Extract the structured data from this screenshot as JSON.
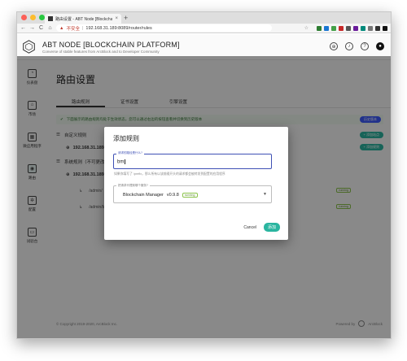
{
  "browser": {
    "tab_title": "路由设置 - ABT Node [Blockchain Pla…",
    "tab_close": "×",
    "new_tab": "+",
    "nav": {
      "back": "←",
      "forward": "→",
      "reload": "C",
      "home": "⌂"
    },
    "security_label": "不安全",
    "url": "192.168.31.189:8089/router/rules",
    "star": "☆"
  },
  "app": {
    "title": "ABT NODE [BLOCKCHAIN PLATFORM]",
    "subtitle": "Converse of stable features from ArcBlock and to Developer Community",
    "header_icons": [
      "globe-icon",
      "bell-icon",
      "help-icon",
      "user-icon"
    ],
    "header_glyphs": [
      "⊕",
      "♪",
      "?",
      "●"
    ]
  },
  "sidebar": {
    "items": [
      {
        "label": "仪表盘",
        "icon": "dashboard-icon",
        "glyph": "◔"
      },
      {
        "label": "市场",
        "icon": "cart-icon",
        "glyph": "⌂"
      },
      {
        "label": "微应用程序",
        "icon": "apps-icon",
        "glyph": "▦"
      },
      {
        "label": "路由",
        "icon": "router-icon",
        "glyph": "◉"
      },
      {
        "label": "配置",
        "icon": "settings-icon",
        "glyph": "✲"
      },
      {
        "label": "试验台",
        "icon": "console-icon",
        "glyph": "▭"
      }
    ]
  },
  "page": {
    "title": "路由设置",
    "tabs": [
      "路由规则",
      "证书设置",
      "引擎设置"
    ],
    "banner_text": "下面展示的路由规则均处于生效状态，您可以通过右边的按钮查看并切换到历史版本",
    "banner_button": "历史版本",
    "custom_section": "自定义规则",
    "system_section": "系统规则（不可更改）",
    "add_rule": "+ 添加站点",
    "add_route": "+ 添加规则",
    "host1": "192.168.31.189",
    "host2": "192.168.31.189",
    "routes": [
      {
        "path": "/admin/",
        "status": "running"
      },
      {
        "path": "/admin/blockchain-manager/",
        "status": "running"
      }
    ],
    "footer_left": "© Copyright 2019-2020, ArcBlock Inc.",
    "footer_right": "Powered by",
    "footer_brand": "ArcBlock"
  },
  "dialog": {
    "title": "添加规则",
    "path_label": "请求的路径是什么?",
    "path_value": "bm",
    "helper": "如果你填写了 /prefix，那么所有以该前缀开头的请求都会被转发到配置的应用程序",
    "app_label": "把请求代理到哪个服务?",
    "app_value": "Blockchain Manager",
    "app_version": "v0.9.8",
    "app_status": "running",
    "dropdown_arrow": "▼",
    "cancel": "Cancel",
    "confirm": "添加"
  },
  "colors": {
    "accent": "#2ab5a0",
    "primary": "#3f51b5",
    "running": "#8bc34a"
  }
}
